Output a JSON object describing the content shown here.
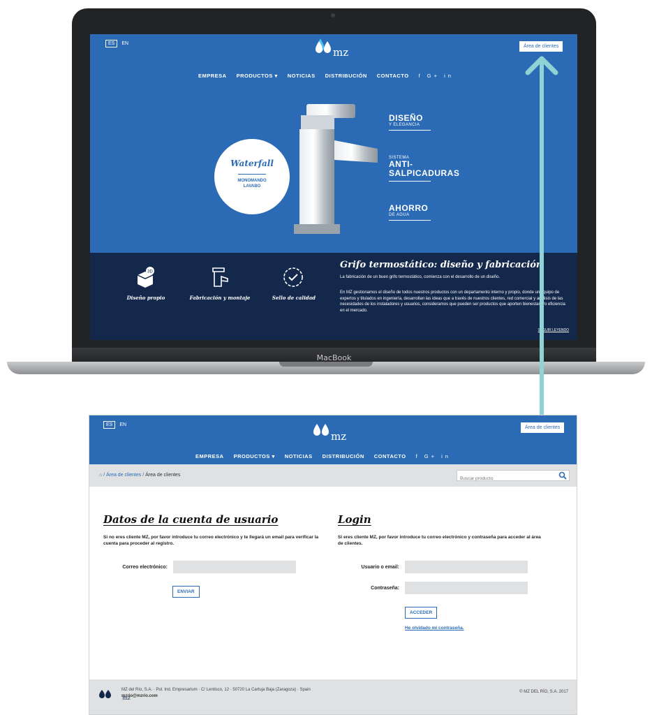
{
  "laptop": {
    "brand": "MacBook",
    "site": {
      "lang_es": "ES",
      "lang_en": "EN",
      "logo": "mz",
      "client_area": "Área de clientes",
      "nav": [
        "EMPRESA",
        "PRODUCTOS ▾",
        "NOTICIAS",
        "DISTRIBUCIÓN",
        "CONTACTO"
      ],
      "social": [
        "f",
        "G+",
        "in"
      ],
      "hero": {
        "product_name": "Waterfall",
        "product_sub1": "MONOMANDO",
        "product_sub2": "LAVABO",
        "feature1_big": "DISEÑO",
        "feature1_small": "Y ELEGANCIA",
        "feature2_small": "SISTEMA",
        "feature2_big1": "ANTI-",
        "feature2_big2": "SALPICADURAS",
        "feature3_big": "AHORRO",
        "feature3_small": "DE AGUA"
      },
      "band": {
        "f1": "Diseño propio",
        "f2": "Fabricación y montaje",
        "f3": "Sello de calidad",
        "title": "Grifo termostático: diseño y fabricación",
        "p1": "La fabricación de un buen grifo termostático, comienza con el desarrollo de un diseño.",
        "p2": "En MZ gestionamos el diseño de todos nuestros productos con un departamento interno y propio, donde un equipo de expertos y titulados en ingeniería, desarrollan las ideas que a través de nuestros clientes, red comercial y análisis de las necesidades de los instaladores y usuarios, consideramos que pueden ser productos que aporten bienestar y/o eficiencia en el mercado.",
        "more": "SEGUIR LEYENDO"
      }
    }
  },
  "page": {
    "lang_es": "ES",
    "lang_en": "EN",
    "logo": "mz",
    "client_area": "Área de clientes",
    "nav": [
      "EMPRESA",
      "PRODUCTOS ▾",
      "NOTICIAS",
      "DISTRIBUCIÓN",
      "CONTACTO"
    ],
    "social": [
      "f",
      "G+",
      "in"
    ],
    "breadcrumb": {
      "link": "Área de clientes",
      "current": "Área de clientes"
    },
    "search_placeholder": "Buscar producto",
    "register": {
      "title": "Datos de la cuenta de usuario",
      "desc": "Si no eres cliente MZ, por favor introduce tu correo electrónico y te llegará un email para verificar la cuenta para proceder al registro.",
      "email_label": "Correo electrónico:",
      "submit": "ENVIAR"
    },
    "login": {
      "title": "Login",
      "desc": "Si eres cliente MZ, por favor introduce tu correo electrónico y contraseña para acceder al área de clientes.",
      "user_label": "Usuario o email:",
      "pass_label": "Contraseña:",
      "submit": "ACCEDER",
      "forgot": "He olvidado mi contraseña."
    },
    "footer": {
      "address": "MZ del Río, S.A. · Pol. Ind. Empresarium · C/ Lentisco, 12 · 50720 La Cartuja Baja (Zaragoza) · Spain",
      "email": "mzrio@mzrio.com",
      "copyright": "© MZ DEL RÍO, S.A. 2017"
    }
  },
  "colors": {
    "brand_blue": "#2b6bb5",
    "dark_navy": "#13284a",
    "arrow_teal": "#8fd3d6"
  }
}
